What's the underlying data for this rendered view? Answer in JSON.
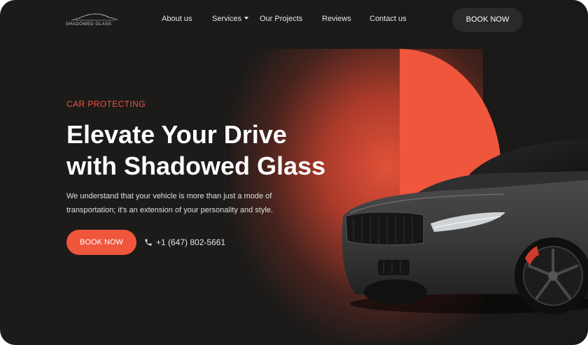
{
  "header": {
    "logo_text": "SHADOWED GLASS",
    "nav": [
      {
        "label": "About us"
      },
      {
        "label": "Services",
        "has_dropdown": true
      },
      {
        "label": "Our Projects"
      },
      {
        "label": "Reviews"
      },
      {
        "label": "Contact us"
      }
    ],
    "book_label": "BOOK NOW"
  },
  "hero": {
    "eyebrow": "CAR PROTECTING",
    "headline_line1": "Elevate Your Drive",
    "headline_line2": "with Shadowed Glass",
    "description_line1": "We understand that your vehicle is more than just a mode of",
    "description_line2": "transportation; it's an extension of your personality and style.",
    "book_label": "BOOK NOW",
    "phone": "+1 (647) 802-5661"
  },
  "colors": {
    "accent": "#f0563c",
    "background": "#1c1b1a",
    "button_dark": "#2b2a29"
  },
  "icons": [
    "car-logo-icon",
    "chevron-down-icon",
    "phone-icon"
  ]
}
